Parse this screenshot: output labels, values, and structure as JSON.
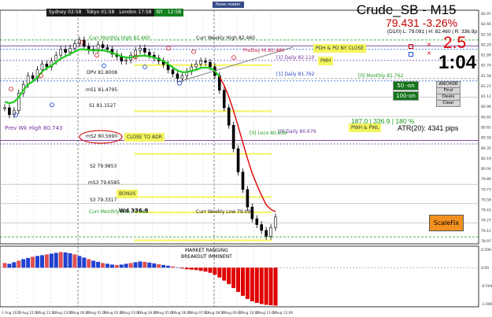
{
  "sessions": {
    "sydney": "Sydney 02:58",
    "tokyo": "Tokyo 01:58",
    "london": "London 17:58",
    "ny_label": "NY",
    "ny_time": "12:58"
  },
  "news_button": "News reader",
  "header": {
    "symbol": "Crude_SB - M15",
    "price": "79.431 -3.26%",
    "ohlc": "(D1/0) L: 79.091 | H: 82.460 | R: 336.9p",
    "spread": "2.5",
    "timer": "1:04"
  },
  "level_labels": {
    "curr_monthly_high": "Curr Monthly High 82.460",
    "curr_weekly_high": "Curr Weekly High 82.460",
    "prev_weekly_high": "Prev Wk High 80.743",
    "pdh_ny": "PDH & PD NY CLOSE",
    "prev_day_high": "PreDay Hi 82.460",
    "daily_label": "[1] Daily 82.110",
    "pmh": "PMH",
    "daily_pivot": "DPV 81.8008",
    "daily_low_label": "[1] Daily 81.762",
    "monthly_label": "[0] Monthly 81.762",
    "ms1": "mS1 81.4795",
    "s1": "S1 81.1527",
    "ms2": "mS2 80.5690",
    "close_to_adr": "CLOSE TO ADR",
    "s2": "S2 79.9853",
    "ms3": "mS3 79.6585",
    "bonus": "BONUS",
    "s3": "S3 79.3317",
    "curr_monthly_low": "Curr Monthly Low 79.091",
    "curr_weekly_low": "Curr Weekly Low 79.091",
    "wd": "Wd 336.9",
    "pwh_pwl": "PWH & PWL",
    "right_level_a": "[0] Daily 80.679",
    "right_level_b": "[0] Loco 80.639"
  },
  "buttons": {
    "fifty": "50 -on",
    "hundred": "100-on",
    "anchor": "ANCHOR",
    "find": "Find",
    "deals": "Deals",
    "clear": "Clear",
    "scalefix": "ScaleFix"
  },
  "adr_text": "187.0 | 336.9 | 180 %",
  "atr_text": "ATR(20): 4341 pips",
  "indicator_note_line1": "MARKET RANGING",
  "indicator_note_line2": "BREAKOUT IMMINENT",
  "price_axis_labels": [
    "82.97",
    "82.66",
    "82.50",
    "82.20",
    "81.89",
    "81.74",
    "81.58",
    "81.27",
    "81.12",
    "80.96",
    "80.81",
    "80.65",
    "80.50",
    "80.35",
    "80.19",
    "80.04",
    "79.89",
    "79.73",
    "79.58",
    "79.43",
    "79.27",
    "79.12",
    "78.97"
  ],
  "indicator_axis_labels": [
    "0.5067",
    "0.00",
    "-0.5044",
    "-1.0000"
  ],
  "time_axis_labels": [
    "1 Aug 2020",
    "1 Aug 21:00",
    "1 Aug 22:00",
    "1 Aug 23:00",
    "2 Aug 00:00",
    "2 Aug 01:00",
    "2 Aug 02:00",
    "2 Aug 03:00",
    "2 Aug 04:00",
    "2 Aug 05:00",
    "2 Aug 06:00",
    "2 Aug 07:00",
    "2 Aug 08:00",
    "2 Aug 09:00",
    "2 Aug 10:00",
    "2 Aug 11:00",
    "2 Aug 12:00"
  ],
  "chart_data": {
    "type": "line",
    "title": "Crude_SB - M15",
    "y_range": [
      78.97,
      82.97
    ],
    "price_series": [
      81.3,
      81.18,
      81.25,
      81.55,
      81.7,
      81.85,
      81.8,
      81.95,
      82.05,
      82.0,
      82.1,
      82.2,
      82.3,
      82.25,
      82.32,
      82.4,
      82.46,
      82.35,
      82.28,
      82.3,
      82.38,
      82.33,
      82.3,
      82.22,
      82.18,
      82.1,
      82.12,
      82.2,
      82.28,
      82.32,
      82.25,
      82.2,
      82.15,
      82.1,
      82.04,
      81.95,
      81.88,
      81.8,
      81.85,
      81.92,
      82.0,
      82.05,
      82.1,
      82.08,
      82.0,
      81.85,
      81.6,
      81.3,
      81.0,
      80.6,
      80.2,
      79.9,
      79.6,
      79.4,
      79.3,
      79.2,
      79.1,
      79.25,
      79.43
    ],
    "moving_average": [
      81.4,
      81.38,
      81.4,
      81.48,
      81.6,
      81.7,
      81.75,
      81.82,
      81.92,
      81.98,
      82.02,
      82.08,
      82.14,
      82.18,
      82.22,
      82.26,
      82.3,
      82.3,
      82.29,
      82.28,
      82.28,
      82.28,
      82.27,
      82.24,
      82.21,
      82.18,
      82.16,
      82.16,
      82.18,
      82.19,
      82.19,
      82.18,
      82.16,
      82.13,
      82.1,
      82.05,
      81.99,
      81.94,
      81.91,
      81.91,
      81.93,
      81.95,
      81.98,
      81.99,
      81.98,
      81.93,
      81.83,
      81.68,
      81.49,
      81.25,
      80.98,
      80.7,
      80.43,
      80.18,
      79.98,
      79.8,
      79.64,
      79.56,
      79.52
    ],
    "indicator": [
      0.12,
      0.1,
      0.14,
      0.18,
      0.22,
      0.25,
      0.28,
      0.3,
      0.32,
      0.34,
      0.36,
      0.38,
      0.4,
      0.39,
      0.37,
      0.34,
      0.3,
      0.26,
      0.22,
      0.18,
      0.15,
      0.12,
      0.1,
      0.08,
      0.07,
      0.08,
      0.1,
      0.12,
      0.14,
      0.16,
      0.15,
      0.13,
      0.11,
      0.09,
      0.07,
      0.05,
      0.03,
      0.01,
      -0.02,
      -0.04,
      -0.05,
      -0.06,
      -0.08,
      -0.1,
      -0.13,
      -0.18,
      -0.25,
      -0.33,
      -0.42,
      -0.52,
      -0.62,
      -0.72,
      -0.8,
      -0.86,
      -0.9,
      -0.93,
      -0.95,
      -0.96,
      -0.97
    ],
    "indicator_range": [
      -1.0,
      0.55
    ]
  }
}
